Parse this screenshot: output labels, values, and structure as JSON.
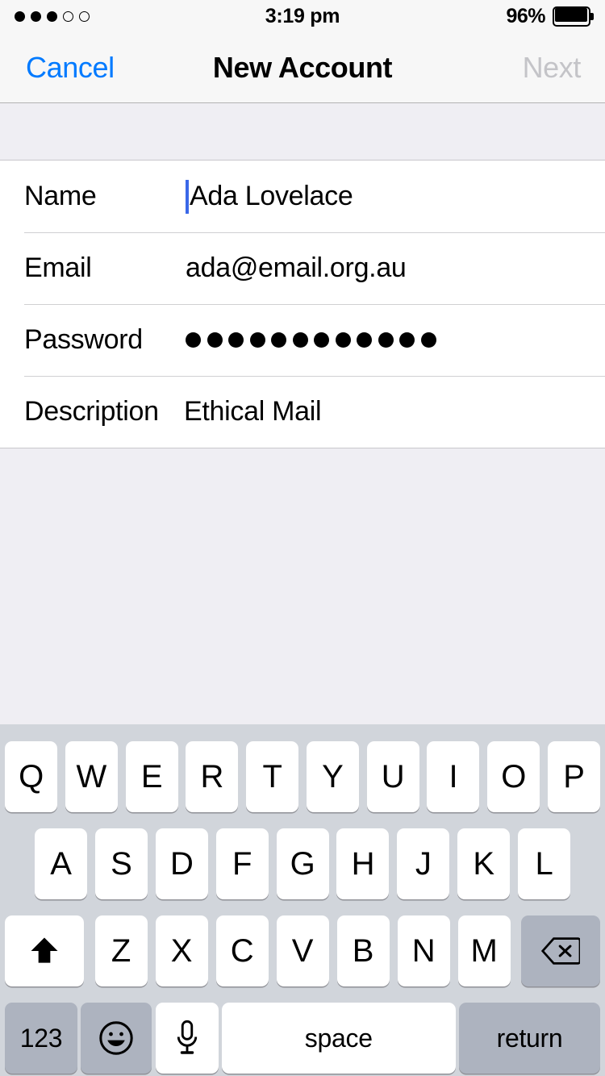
{
  "status_bar": {
    "signal": {
      "icon": "signal-dots",
      "filled": 3,
      "total": 5
    },
    "time": "3:19 pm",
    "battery_percent": "96%",
    "battery_level": 96
  },
  "nav_bar": {
    "cancel_label": "Cancel",
    "title": "New Account",
    "next_label": "Next",
    "next_enabled": false,
    "tint_color": "#007AFF",
    "disabled_color": "#C4C4C8"
  },
  "form": {
    "rows": [
      {
        "label": "Name",
        "value": "Ada Lovelace",
        "type": "text",
        "focused": true
      },
      {
        "label": "Email",
        "value": "ada@email.org.au",
        "type": "email",
        "focused": false
      },
      {
        "label": "Password",
        "value": "",
        "type": "password",
        "masked_length": 12,
        "focused": false
      },
      {
        "label": "Description",
        "value": "Ethical Mail",
        "type": "text",
        "focused": false
      }
    ],
    "caret_color": "#3A68E8"
  },
  "keyboard": {
    "layout": "qwerty-uppercase",
    "background": "#D1D5DB",
    "row1": [
      "Q",
      "W",
      "E",
      "R",
      "T",
      "Y",
      "U",
      "I",
      "O",
      "P"
    ],
    "row2": [
      "A",
      "S",
      "D",
      "F",
      "G",
      "H",
      "J",
      "K",
      "L"
    ],
    "row3": [
      "Z",
      "X",
      "C",
      "V",
      "B",
      "N",
      "M"
    ],
    "shift": {
      "icon": "shift-arrow-up-icon",
      "active": true
    },
    "backspace": {
      "icon": "backspace-delete-icon"
    },
    "numbers_label": "123",
    "emoji": {
      "icon": "emoji-smiley-icon"
    },
    "dictation": {
      "icon": "microphone-icon"
    },
    "space_label": "space",
    "return_label": "return"
  }
}
